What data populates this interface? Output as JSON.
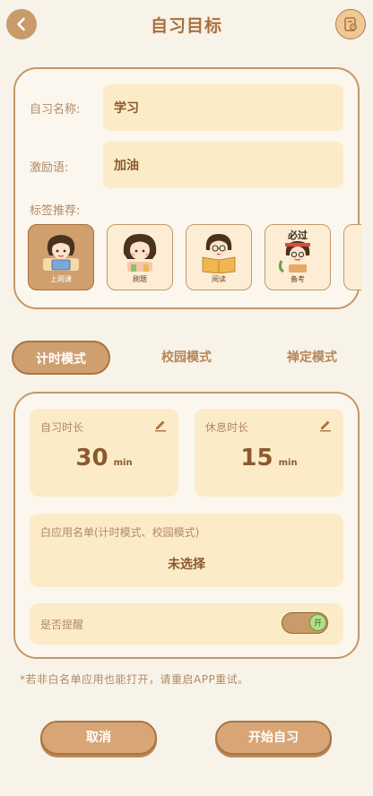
{
  "header": {
    "title": "自习目标",
    "back_icon": "chevron-left-icon",
    "history_icon": "history-icon"
  },
  "form": {
    "name_label": "自习名称:",
    "name_value": "学习",
    "motto_label": "激励语:",
    "motto_value": "加油",
    "tags_label": "标签推荐:",
    "tags": [
      {
        "label": "上网课",
        "icon": "laptop-girl-icon",
        "selected": true
      },
      {
        "label": "刷题",
        "icon": "thinking-girl-icon",
        "selected": false
      },
      {
        "label": "阅读",
        "icon": "reading-girl-icon",
        "selected": false
      },
      {
        "label": "备考",
        "icon": "exam-girl-icon",
        "badge": "必过",
        "selected": false
      }
    ]
  },
  "modes": {
    "items": [
      "计时模式",
      "校园模式",
      "禅定模式"
    ],
    "active": "计时模式"
  },
  "timer": {
    "study_label": "自习时长",
    "study_value": "30",
    "study_unit": "min",
    "rest_label": "休息时长",
    "rest_value": "15",
    "rest_unit": "min",
    "whitelist_label": "白应用名单(计时模式、校园模式)",
    "whitelist_value": "未选择",
    "remind_label": "是否提醒",
    "remind_toggle_label": "开",
    "remind_on": true
  },
  "note": "*若非白名单应用也能打开，请重启APP重试。",
  "buttons": {
    "cancel": "取消",
    "start": "开始自习"
  },
  "colors": {
    "accent": "#d09f6f",
    "card_bg": "#fcebc7",
    "page_bg": "#f8f3e9",
    "text": "#8a5a2e"
  }
}
